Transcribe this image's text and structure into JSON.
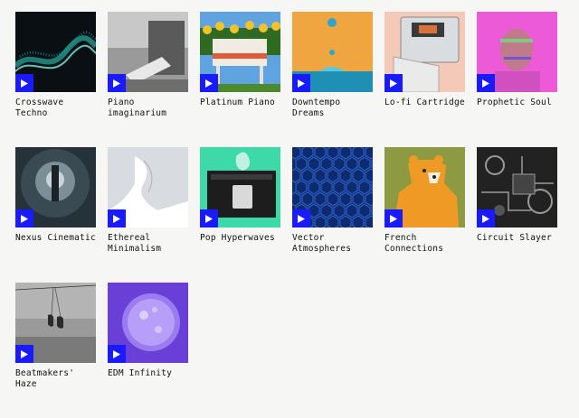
{
  "tracks": [
    {
      "title": "Crosswave Techno",
      "art_icon": "particle-wave-art",
      "colors": {
        "bg": "#0a0f14",
        "accent": "#2fd7c4"
      }
    },
    {
      "title": "Piano imaginarium",
      "art_icon": "grayscale-piano-art",
      "colors": {
        "bg": "#9a9a9a",
        "accent": "#e8e8e8"
      }
    },
    {
      "title": "Platinum Piano",
      "art_icon": "sunflower-piano-art",
      "colors": {
        "bg": "#5fa3e0",
        "accent": "#f2c22a"
      }
    },
    {
      "title": "Downtempo Dreams",
      "art_icon": "water-drop-art",
      "colors": {
        "bg": "#f0a640",
        "accent": "#2ea6c8"
      }
    },
    {
      "title": "Lo-fi Cartridge",
      "art_icon": "cassette-player-art",
      "colors": {
        "bg": "#f4c9b8",
        "accent": "#d9dde0"
      }
    },
    {
      "title": "Prophetic Soul",
      "art_icon": "glitch-portrait-art",
      "colors": {
        "bg": "#ec5ad8",
        "accent": "#6de07a"
      }
    },
    {
      "title": "Nexus Cinematic",
      "art_icon": "tunnel-skyscraper-art",
      "colors": {
        "bg": "#26323a",
        "accent": "#c9d3d8"
      }
    },
    {
      "title": "Ethereal Minimalism",
      "art_icon": "paper-sculpture-art",
      "colors": {
        "bg": "#d8dce0",
        "accent": "#ffffff"
      }
    },
    {
      "title": "Pop Hyperwaves",
      "art_icon": "retro-computer-art",
      "colors": {
        "bg": "#3dd9a8",
        "accent": "#1d1d1d"
      }
    },
    {
      "title": "Vector Atmospheres",
      "art_icon": "hexagon-pattern-art",
      "colors": {
        "bg": "#0f2a6e",
        "accent": "#2f6bd6"
      }
    },
    {
      "title": "French Connections",
      "art_icon": "orange-bear-art",
      "colors": {
        "bg": "#8e9a42",
        "accent": "#f09a26"
      }
    },
    {
      "title": "Circuit Slayer",
      "art_icon": "circuit-board-art",
      "colors": {
        "bg": "#222222",
        "accent": "#9a9a9a"
      }
    },
    {
      "title": "Beatmakers' Haze",
      "art_icon": "hanging-sneakers-art",
      "colors": {
        "bg": "#9a9a9a",
        "accent": "#2a2a2a"
      }
    },
    {
      "title": "EDM Infinity",
      "art_icon": "purple-sphere-art",
      "colors": {
        "bg": "#6a3fd8",
        "accent": "#c9b6ff"
      }
    }
  ],
  "play_button_color": "#1a1aff"
}
